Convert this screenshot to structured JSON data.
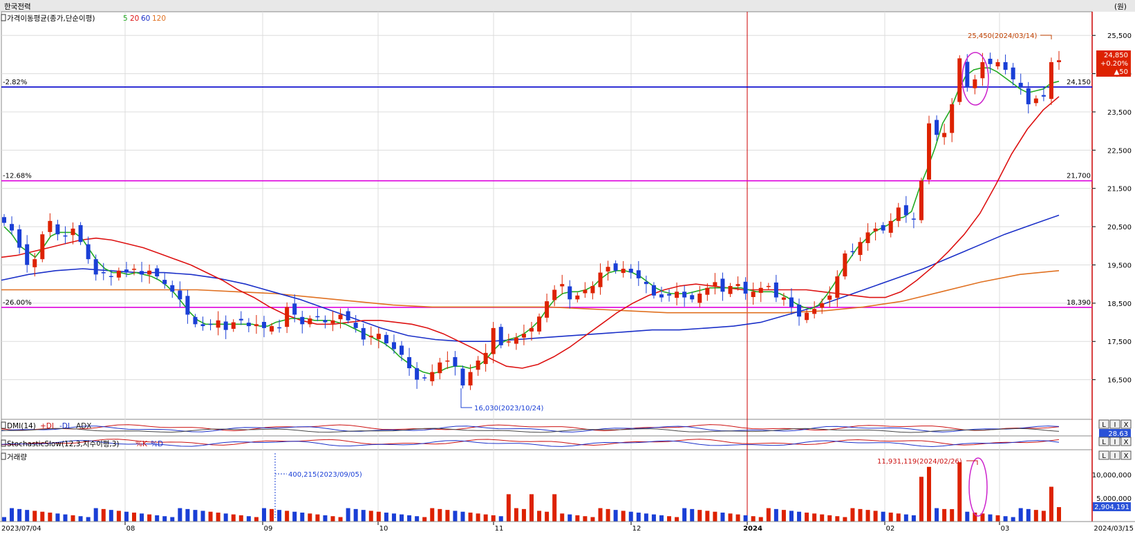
{
  "window": {
    "stock_name": "한국전력",
    "unit": "(원)"
  },
  "price_panel": {
    "legend_title": "가격이동평균(종가,단순이평)",
    "ma_labels": [
      "5",
      "20",
      "60",
      "120"
    ],
    "price_box": {
      "price": "24,850",
      "change_pct": "+0.20%",
      "change": "▲50"
    },
    "high_annotation": "25,450(2024/03/14)",
    "low_annotation": "16,030(2023/10/24)",
    "hlines": [
      {
        "pct": "-2.82%",
        "value": "24,150",
        "price": 24150,
        "color": "#0000cc"
      },
      {
        "pct": "-12.68%",
        "value": "21,700",
        "price": 21700,
        "color": "#dd00dd"
      },
      {
        "pct": "-26.00%",
        "value": "18,390",
        "price": 18390,
        "color": "#dd00dd"
      }
    ]
  },
  "dmi_panel": {
    "legend_title": "DMI(14)",
    "items": [
      "+DI",
      "-DI",
      "ADX"
    ],
    "value": "28.63"
  },
  "stoch_panel": {
    "legend_title": "StochasticSlow(12,3,지수이평,3)",
    "items": [
      "%K",
      "%D"
    ]
  },
  "volume_panel": {
    "legend_title": "거래량",
    "max_annotation": "11,931,119(2024/02/26)",
    "low_annotation": "400,215(2023/09/05)",
    "last_value": "2,904,191",
    "y_ticks": [
      "10,000,000",
      "5,000,000"
    ]
  },
  "x_axis": {
    "labels": [
      "2023/07/04",
      "08",
      "09",
      "10",
      "11",
      "12",
      "2024",
      "02",
      "03",
      "2024/03/15"
    ]
  },
  "panel_buttons": [
    "L",
    "I",
    "X"
  ],
  "colors": {
    "up": "#dd2200",
    "down": "#1a3fd6",
    "ma5": "#22aa22",
    "ma20": "#dd1111",
    "ma60": "#1a2fc8",
    "ma120": "#e07020",
    "grid": "#dcdcdc",
    "year_line": "#cc0000"
  },
  "chart_data": {
    "type": "candlestick",
    "title": "한국전력",
    "unit": "원",
    "y_ticks": [
      25500,
      24500,
      23500,
      22500,
      21500,
      20500,
      19500,
      18500,
      17500,
      16500
    ],
    "ylim": [
      15500,
      26100
    ],
    "period": [
      "2023/07/04",
      "2024/03/15"
    ],
    "month_starts": [
      "08",
      "09",
      "10",
      "11",
      "12",
      "2024",
      "02",
      "03"
    ],
    "candles_approx_close": [
      20600,
      20400,
      19950,
      19500,
      19650,
      20300,
      20650,
      20300,
      20250,
      20450,
      20100,
      19650,
      19250,
      19300,
      19200,
      19350,
      19300,
      19400,
      19250,
      19350,
      19200,
      19000,
      18800,
      18600,
      18200,
      17950,
      17900,
      17950,
      18050,
      17800,
      18000,
      18050,
      17900,
      17950,
      17850,
      17900,
      17850,
      18400,
      18200,
      17950,
      18100,
      18150,
      18000,
      18050,
      18200,
      18050,
      17850,
      17550,
      17650,
      17700,
      17450,
      17300,
      17150,
      16800,
      16500,
      16550,
      16700,
      16950,
      17000,
      16850,
      16350,
      16700,
      17000,
      17200,
      17850,
      17400,
      17500,
      17600,
      17700,
      17850,
      18150,
      18550,
      18850,
      19000,
      18600,
      18700,
      18850,
      18950,
      19300,
      19450,
      19350,
      19400,
      19300,
      19150,
      19000,
      18700,
      18650,
      18700,
      18800,
      18650,
      18600,
      18750,
      18900,
      19050,
      18800,
      18950,
      19000,
      18750,
      18800,
      18900,
      18950,
      18650,
      18650,
      18400,
      18150,
      18250,
      18350,
      18500,
      18700,
      19200,
      19800,
      19850,
      20100,
      20350,
      20450,
      20400,
      20650,
      21000,
      20800,
      20700,
      21700,
      23200,
      22900,
      22950,
      23700,
      24900,
      24150,
      24350,
      24800,
      24750,
      24800,
      24600,
      24350,
      24150,
      23700,
      23850,
      23900,
      24800,
      24850
    ],
    "ma5_approx": [
      20500,
      20300,
      20000,
      19850,
      19700,
      19950,
      20250,
      20350,
      20350,
      20350,
      20200,
      19900,
      19600,
      19400,
      19300,
      19300,
      19250,
      19300,
      19250,
      19200,
      19100,
      18950,
      18750,
      18500,
      18250,
      18050,
      17950,
      17950,
      17950,
      17950,
      17950,
      17950,
      17950,
      17900,
      17900,
      18000,
      18050,
      18100,
      18100,
      18100,
      18050,
      18050,
      18050,
      18000,
      17950,
      17850,
      17750,
      17650,
      17550,
      17450,
      17300,
      17100,
      16950,
      16800,
      16700,
      16650,
      16700,
      16800,
      16850,
      16850,
      16800,
      16850,
      17000,
      17250,
      17450,
      17550,
      17600,
      17700,
      17850,
      18050,
      18350,
      18600,
      18750,
      18800,
      18800,
      18850,
      18950,
      19150,
      19300,
      19350,
      19350,
      19300,
      19200,
      19050,
      18900,
      18800,
      18750,
      18750,
      18750,
      18800,
      18850,
      18900,
      18900,
      18900,
      18900,
      18900,
      18850,
      18800,
      18800,
      18800,
      18750,
      18650,
      18500,
      18400,
      18350,
      18450,
      18700,
      19000,
      19350,
      19650,
      19950,
      20150,
      20350,
      20450,
      20550,
      20700,
      20750,
      20900,
      21500,
      22000,
      22550,
      23200,
      23550,
      24050,
      24450,
      24600,
      24650,
      24650,
      24550,
      24400,
      24250,
      24100,
      24000,
      24050,
      24100,
      24250,
      24300
    ],
    "ma20_approx": [
      19700,
      19750,
      19850,
      19950,
      20050,
      20150,
      20200,
      20150,
      20050,
      19950,
      19800,
      19650,
      19500,
      19300,
      19100,
      18850,
      18650,
      18400,
      18200,
      18050,
      17950,
      17950,
      18000,
      18050,
      18050,
      18000,
      17950,
      17850,
      17700,
      17500,
      17300,
      17050,
      16850,
      16800,
      16900,
      17100,
      17350,
      17650,
      17950,
      18250,
      18500,
      18700,
      18850,
      18950,
      19000,
      18950,
      18900,
      18850,
      18850,
      18850,
      18850,
      18850,
      18800,
      18750,
      18700,
      18650,
      18650,
      18800,
      19100,
      19450,
      19850,
      20300,
      20850,
      21600,
      22400,
      23050,
      23550,
      23900
    ],
    "ma60_approx": [
      19100,
      19250,
      19350,
      19400,
      19350,
      19300,
      19300,
      19250,
      19150,
      19000,
      18800,
      18600,
      18350,
      18100,
      17850,
      17650,
      17550,
      17500,
      17500,
      17550,
      17600,
      17650,
      17700,
      17750,
      17800,
      17800,
      17850,
      17900,
      18000,
      18200,
      18400,
      18650,
      18900,
      19150,
      19400,
      19700,
      20000,
      20300,
      20550,
      20800
    ],
    "ma120_approx": [
      18850,
      18850,
      18850,
      18850,
      18850,
      18850,
      18800,
      18750,
      18650,
      18550,
      18450,
      18400,
      18400,
      18400,
      18400,
      18350,
      18300,
      18250,
      18250,
      18250,
      18250,
      18300,
      18400,
      18550,
      18800,
      19050,
      19250,
      19350
    ],
    "volume_max": 11931119,
    "volume_last": 2904191,
    "volume_y_ticks": [
      10000000,
      5000000
    ]
  }
}
